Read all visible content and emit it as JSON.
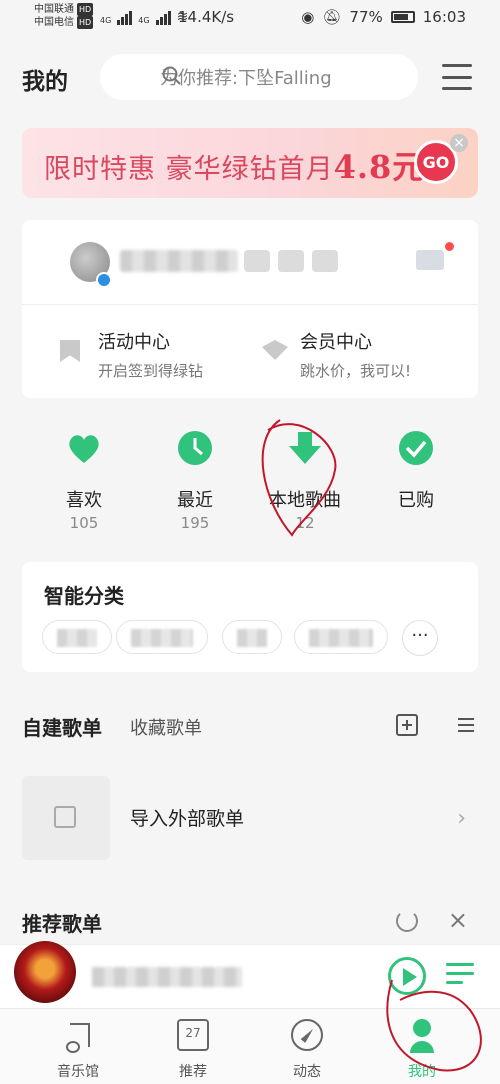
{
  "status_bar": {
    "carrier1": "中国联通",
    "carrier2": "中国电信",
    "hd": "HD",
    "net1": "4G",
    "net2": "4G",
    "speed": "14.4K/s",
    "battery": "77%",
    "time": "16:03"
  },
  "header": {
    "title": "我的",
    "search_placeholder": "为你推荐:下坠Falling"
  },
  "banner": {
    "text_main": "限时特惠 豪华绿钻首月",
    "price": "4.8元",
    "go_label": "GO",
    "close": "×"
  },
  "user_card": {
    "activity": {
      "title": "活动中心",
      "subtitle": "开启签到得绿钻"
    },
    "vip": {
      "title": "会员中心",
      "subtitle": "跳水价，我可以!"
    }
  },
  "quick": [
    {
      "label": "喜欢",
      "count": "105",
      "icon": "heart-icon"
    },
    {
      "label": "最近",
      "count": "195",
      "icon": "clock-icon"
    },
    {
      "label": "本地歌曲",
      "count": "12",
      "icon": "download-icon"
    },
    {
      "label": "已购",
      "count": "",
      "icon": "check-icon"
    }
  ],
  "smart": {
    "title": "智能分类",
    "more": "···"
  },
  "playlists": {
    "tab_created": "自建歌单",
    "tab_collected": "收藏歌单",
    "import_label": "导入外部歌单",
    "chevron": "›"
  },
  "recommend": {
    "title": "推荐歌单",
    "close": "×"
  },
  "nav": [
    {
      "label": "音乐馆"
    },
    {
      "label": "推荐",
      "day": "27"
    },
    {
      "label": "动态"
    },
    {
      "label": "我的"
    }
  ],
  "colors": {
    "accent": "#31c27c",
    "banner_red": "#e8384f"
  }
}
